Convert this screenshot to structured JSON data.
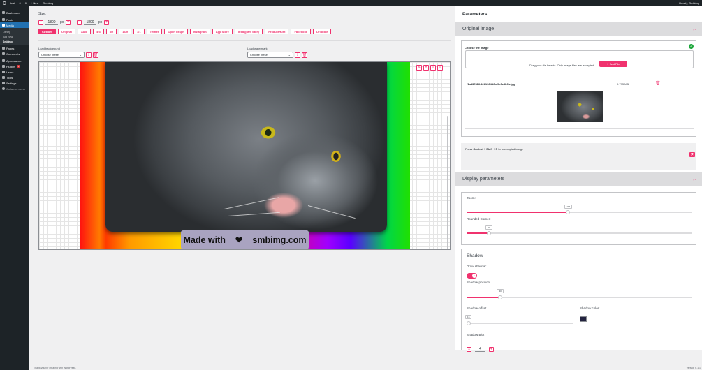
{
  "adminbar": {
    "items": [
      "test",
      "0",
      "0",
      "+ New",
      "Smbimg"
    ],
    "greeting": "Howdy, Smbimg"
  },
  "sidebar": {
    "items": [
      {
        "label": "Dashboard",
        "icon": "dashboard-icon"
      },
      {
        "label": "Posts",
        "icon": "pin-icon"
      },
      {
        "label": "Media",
        "icon": "media-icon",
        "active": true
      }
    ],
    "submenu": [
      "Library",
      "Add New",
      "Smbimg"
    ],
    "items2": [
      {
        "label": "Pages",
        "icon": "page-icon"
      },
      {
        "label": "Comments",
        "icon": "comment-icon"
      },
      {
        "label": "Appearance",
        "icon": "brush-icon"
      },
      {
        "label": "Plugins",
        "icon": "plugin-icon",
        "badge": "1"
      },
      {
        "label": "Users",
        "icon": "user-icon"
      },
      {
        "label": "Tools",
        "icon": "wrench-icon"
      },
      {
        "label": "Settings",
        "icon": "settings-icon"
      },
      {
        "label": "Collapse menu",
        "icon": "collapse-icon"
      }
    ]
  },
  "size": {
    "label": "Size:",
    "width": "1800",
    "height": "1800",
    "unit": "px",
    "minus": "−",
    "plus": "+"
  },
  "ratios": [
    "Custom",
    "Original",
    "Auto",
    "4/3",
    "3/2",
    "16/9",
    "1/1",
    "Twitter",
    "Open Graph",
    "Instagram",
    "App Store",
    "Instagram Story",
    "ProductHunt",
    "Facebook",
    "Dribbble"
  ],
  "background": {
    "label": "Load background",
    "select": "Choose preset"
  },
  "watermark_load": {
    "label": "Load watermark",
    "select": "Choose preset"
  },
  "canvas": {
    "watermark_left": "Made with",
    "watermark_heart": "❤",
    "watermark_right": "smbimg.com"
  },
  "panel": {
    "title": "Parameters",
    "original_section": "Original image",
    "choose_title": "Choose the image",
    "drop_text": "Drag your file here to. Only image files are accepted.",
    "add_files": "Add File",
    "file_name": "f1a437816.4281984d6af9c0c3b0b.jpg",
    "file_size": "0.793 MB",
    "paste_pre": "Press ",
    "paste_keys": "Control + Shift + P",
    "paste_post": " to use copied image",
    "display_section": "Display parameters",
    "zoom_label": "Zoom:",
    "zoom_value": "115",
    "zoom_fraction": 0.45,
    "corner_label": "Rounded Corner:",
    "corner_value": "20",
    "corner_fraction": 0.1,
    "shadow_title": "Shadow",
    "draw_shadow_label": "Draw shadow:",
    "draw_shadow_on": true,
    "shadow_position_label": "Shadow position",
    "shadow_position_value": "40",
    "shadow_position_fraction": 0.15,
    "shadow_offset_label": "Shadow offset",
    "shadow_offset_value": "15",
    "shadow_offset_fraction": 0.02,
    "shadow_color_label": "Shadow color:",
    "shadow_color": "#23233f",
    "shadow_blur_label": "Shadow Blur:",
    "shadow_blur_value": "4"
  },
  "footer": {
    "left": "Thank you for creating with WordPress.",
    "right": "Version 6.1.1"
  },
  "colors": {
    "accent": "#f0326e",
    "admin_dark": "#1d2327",
    "admin_blue": "#2271b1",
    "success": "#1ea73c"
  }
}
